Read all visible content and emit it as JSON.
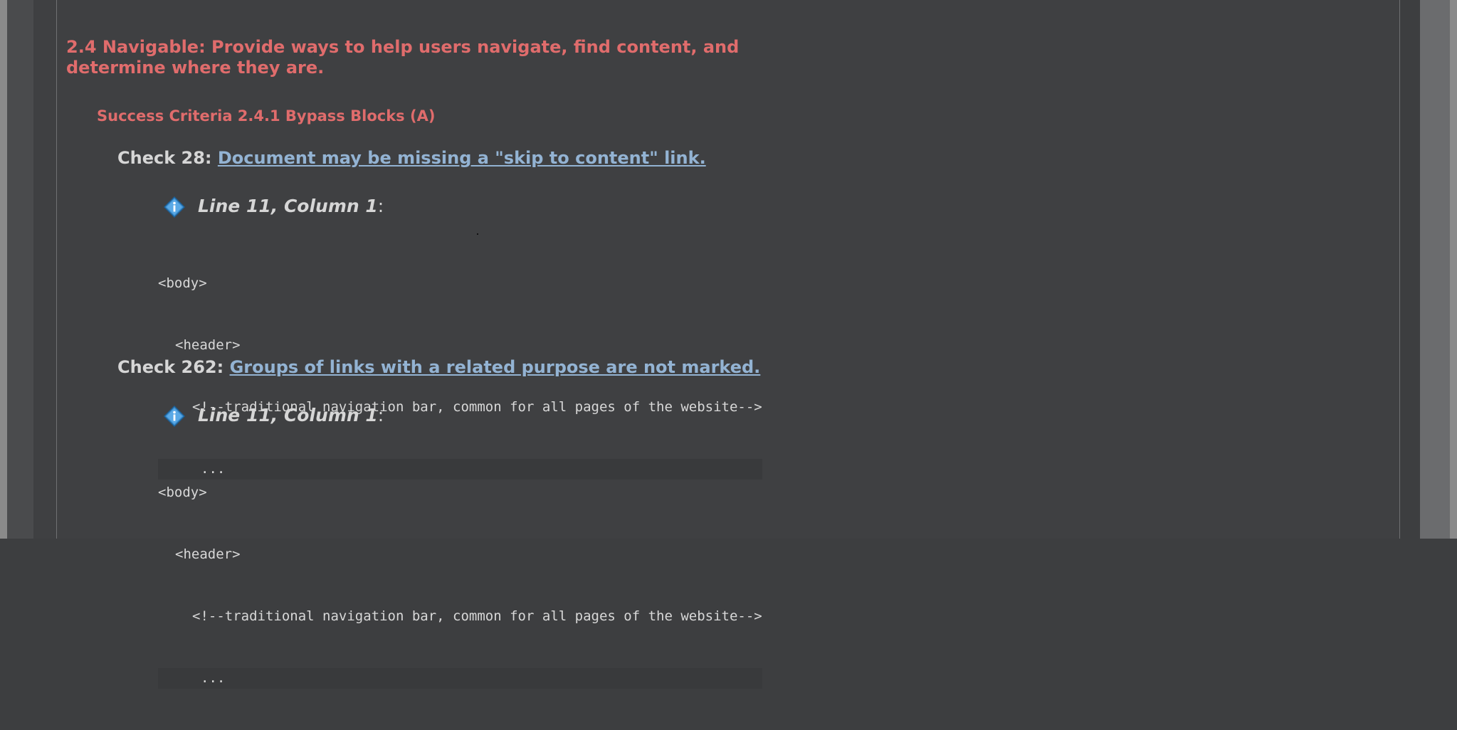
{
  "guideline": {
    "title": "2.4 Navigable: Provide ways to help users navigate, find content, and determine where they are."
  },
  "criterion": {
    "title": "Success Criteria 2.4.1 Bypass Blocks (A)"
  },
  "checks": [
    {
      "label": "Check 28:",
      "link": "Document may be missing a \"skip to content\" link.",
      "location": "Line 11, Column 1",
      "colon": ":",
      "code": [
        "<body>",
        "<header>",
        "<!--traditional navigation bar, common for all pages of the website-->",
        "..."
      ]
    },
    {
      "label": "Check 262:",
      "link": "Groups of links with a related purpose are not marked.",
      "location": "Line 11, Column 1",
      "colon": ":",
      "code": [
        "<body>",
        "<header>",
        "<!--traditional navigation bar, common for all pages of the website-->",
        "..."
      ]
    }
  ],
  "colors": {
    "background": "#3f4042",
    "heading": "#e06c6c",
    "link": "#93b3d3",
    "text": "#d6d6d6",
    "info_icon": "#3d8fd0"
  },
  "icons": {
    "info": "info-diamond-icon"
  }
}
